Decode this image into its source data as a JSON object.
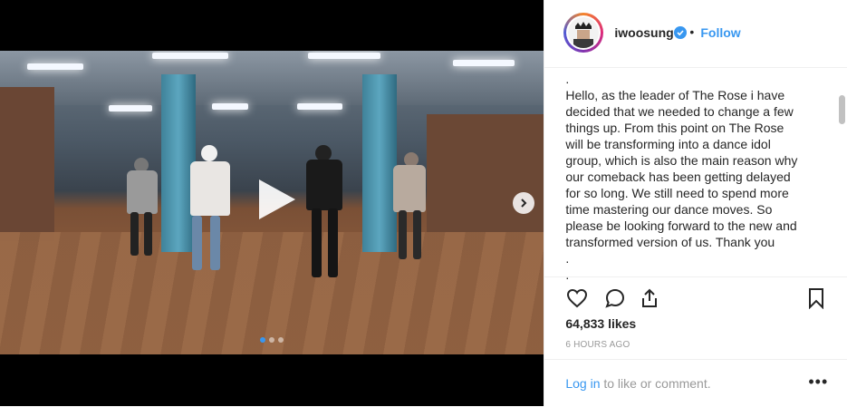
{
  "post": {
    "username": "iwoosung",
    "separator": "•",
    "follow_label": "Follow",
    "caption_lines": [
      ".",
      "Hello, as the leader of The Rose i have",
      "decided that we needed to change a few",
      "things up. From this point on The Rose",
      "will be transforming into a dance idol",
      "group, which is also the main reason why",
      "our comeback has been getting delayed",
      "for so long. We still need to spend more",
      "time mastering our dance moves. So",
      "please be looking forward to the new and",
      "transformed version of us. Thank you",
      ".",
      "."
    ],
    "likes": "64,833 likes",
    "timestamp": "6 HOURS AGO",
    "login_label": "Log in",
    "login_suffix": "to like or comment.",
    "more_label": "•••"
  },
  "media": {
    "slide_count": 3,
    "active_slide": 1
  },
  "colors": {
    "accent": "#3897f0",
    "text": "#262626",
    "muted": "#999999",
    "border": "#efefef"
  },
  "icons": [
    "verified-badge-icon",
    "play-icon",
    "next-arrow-icon",
    "heart-icon",
    "comment-icon",
    "share-icon",
    "bookmark-icon"
  ]
}
